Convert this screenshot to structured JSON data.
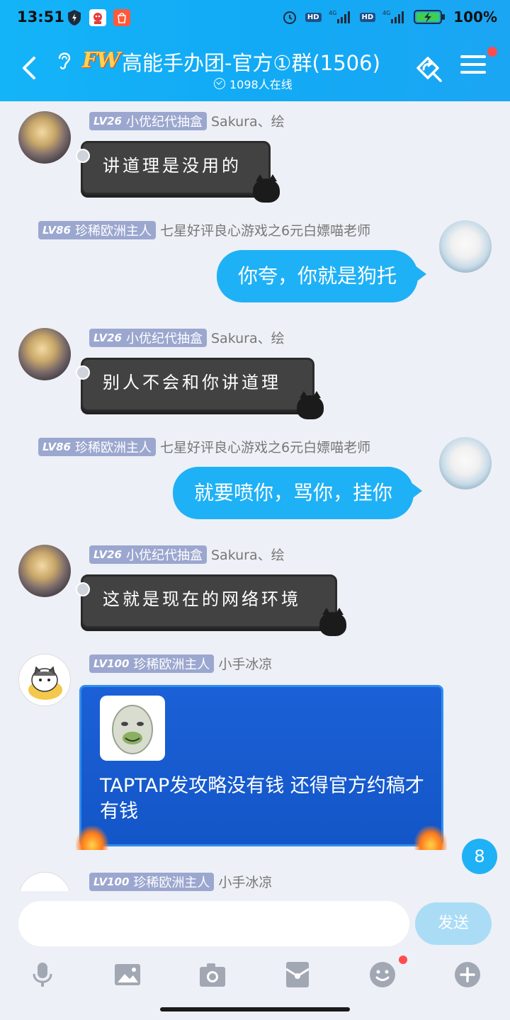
{
  "status_bar": {
    "time": "13:51",
    "battery_percent": "100%",
    "hd1": "HD",
    "hd2": "HD",
    "net": "4G"
  },
  "header": {
    "logo": "FW",
    "title": "高能手办团-官方①群(1506)",
    "online": "1098人在线"
  },
  "messages": [
    {
      "side": "left",
      "level": "LV26",
      "title": "小优纪代抽盒",
      "nick": "Sakura、绘",
      "text": "讲道理是没用的"
    },
    {
      "side": "right",
      "level": "LV86",
      "title": "珍稀欧洲主人",
      "nick": "七星好评良心游戏之6元白嫖喵老师",
      "text": "你夸，你就是狗托"
    },
    {
      "side": "left",
      "level": "LV26",
      "title": "小优纪代抽盒",
      "nick": "Sakura、绘",
      "text": "别人不会和你讲道理"
    },
    {
      "side": "right",
      "level": "LV86",
      "title": "珍稀欧洲主人",
      "nick": "七星好评良心游戏之6元白嫖喵老师",
      "text": "就要喷你，骂你，挂你"
    },
    {
      "side": "left",
      "level": "LV26",
      "title": "小优纪代抽盒",
      "nick": "Sakura、绘",
      "text": "这就是现在的网络环境"
    },
    {
      "side": "left",
      "level": "LV100",
      "title": "珍稀欧洲主人",
      "nick": "小手冰凉",
      "text": "TAPTAP发攻略没有钱 还得官方约稿才有钱"
    },
    {
      "side": "left",
      "level": "LV100",
      "title": "珍稀欧洲主人",
      "nick": "小手冰凉",
      "text": ""
    }
  ],
  "unread_count": "8",
  "input": {
    "placeholder": "",
    "send_label": "发送"
  },
  "colors": {
    "header": "#14b4f8",
    "bubble_self": "#1fb1f6",
    "bubble_dark": "#424242",
    "background": "#edf0f6"
  }
}
